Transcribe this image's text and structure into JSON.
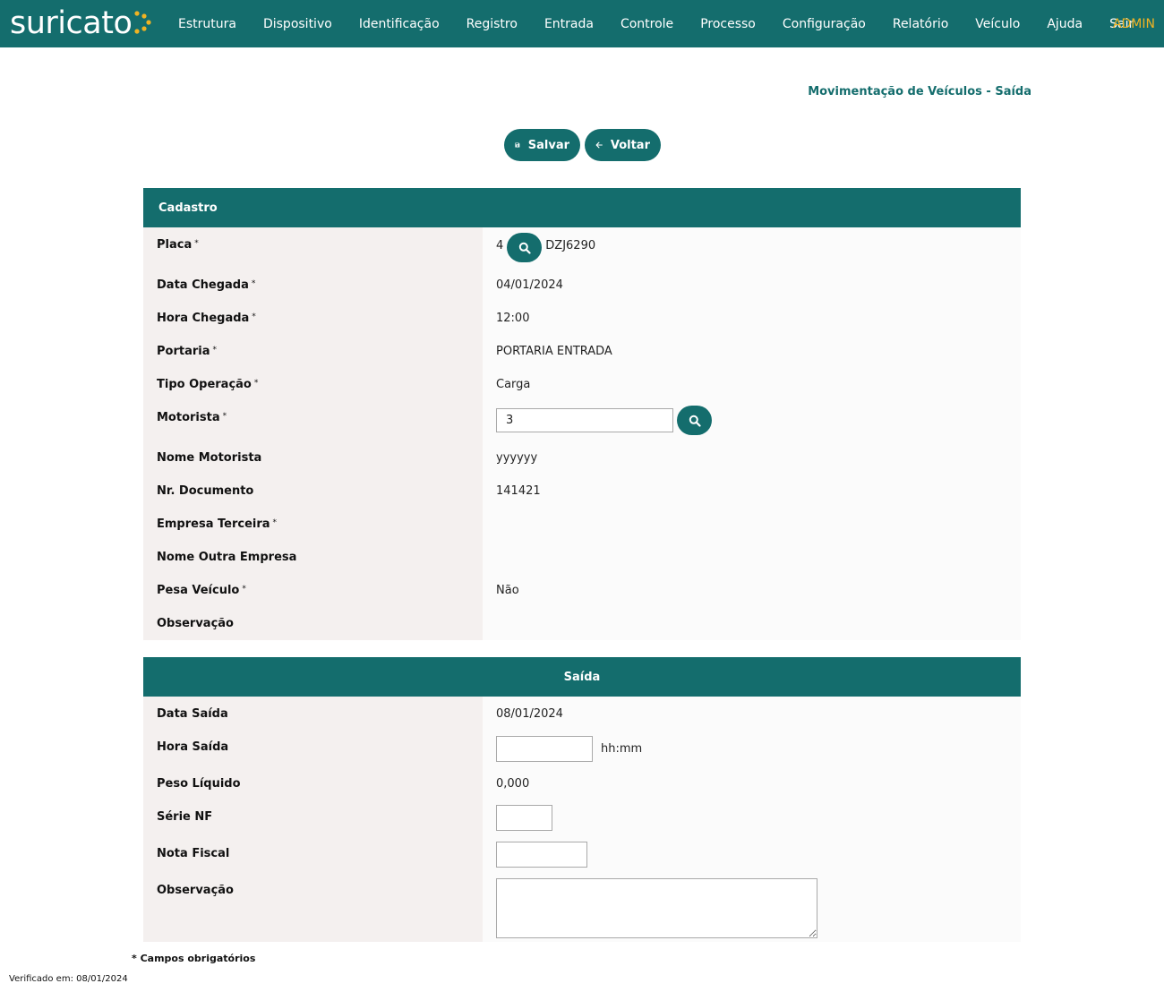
{
  "brand": {
    "logo_text": "suricato"
  },
  "nav": {
    "items": [
      "Estrutura",
      "Dispositivo",
      "Identificação",
      "Registro",
      "Entrada",
      "Controle",
      "Processo",
      "Configuração",
      "Relatório",
      "Veículo",
      "Ajuda",
      "Sair"
    ],
    "user": "ADMIN"
  },
  "page": {
    "title": "Movimentação de Veículos - Saída"
  },
  "toolbar": {
    "save_label": "Salvar",
    "back_label": "Voltar"
  },
  "cadastro": {
    "header": "Cadastro",
    "placa": {
      "label": "Placa",
      "required": "*",
      "code": "4",
      "value": "DZJ6290"
    },
    "data_chegada": {
      "label": "Data Chegada",
      "required": "*",
      "value": "04/01/2024"
    },
    "hora_chegada": {
      "label": "Hora Chegada",
      "required": "*",
      "value": "12:00"
    },
    "portaria": {
      "label": "Portaria",
      "required": "*",
      "value": "PORTARIA ENTRADA"
    },
    "tipo_operacao": {
      "label": "Tipo Operação",
      "required": "*",
      "value": "Carga"
    },
    "motorista": {
      "label": "Motorista",
      "required": "*",
      "value": "3"
    },
    "nome_motorista": {
      "label": "Nome Motorista",
      "value": "yyyyyy"
    },
    "nr_documento": {
      "label": "Nr. Documento",
      "value": "141421"
    },
    "empresa_terceira": {
      "label": "Empresa Terceira",
      "required": "*",
      "value": ""
    },
    "nome_outra_empresa": {
      "label": "Nome Outra Empresa",
      "value": ""
    },
    "pesa_veiculo": {
      "label": "Pesa Veículo",
      "required": "*",
      "value": "Não"
    },
    "observacao": {
      "label": "Observação",
      "value": ""
    }
  },
  "saida": {
    "header": "Saída",
    "data_saida": {
      "label": "Data Saída",
      "value": "08/01/2024"
    },
    "hora_saida": {
      "label": "Hora Saída",
      "value": "",
      "hint": "hh:mm"
    },
    "peso_liquido": {
      "label": "Peso Líquido",
      "value": "0,000"
    },
    "serie_nf": {
      "label": "Série NF",
      "value": ""
    },
    "nota_fiscal": {
      "label": "Nota Fiscal",
      "value": ""
    },
    "observacao": {
      "label": "Observação",
      "value": ""
    }
  },
  "footer": {
    "required_note": "* Campos obrigatórios",
    "verified": "Verificado em: 08/01/2024"
  },
  "colors": {
    "primary": "#146d6d",
    "accent": "#f0b323",
    "label_bg": "#f4f0ef",
    "value_bg": "#fbfbfb"
  }
}
